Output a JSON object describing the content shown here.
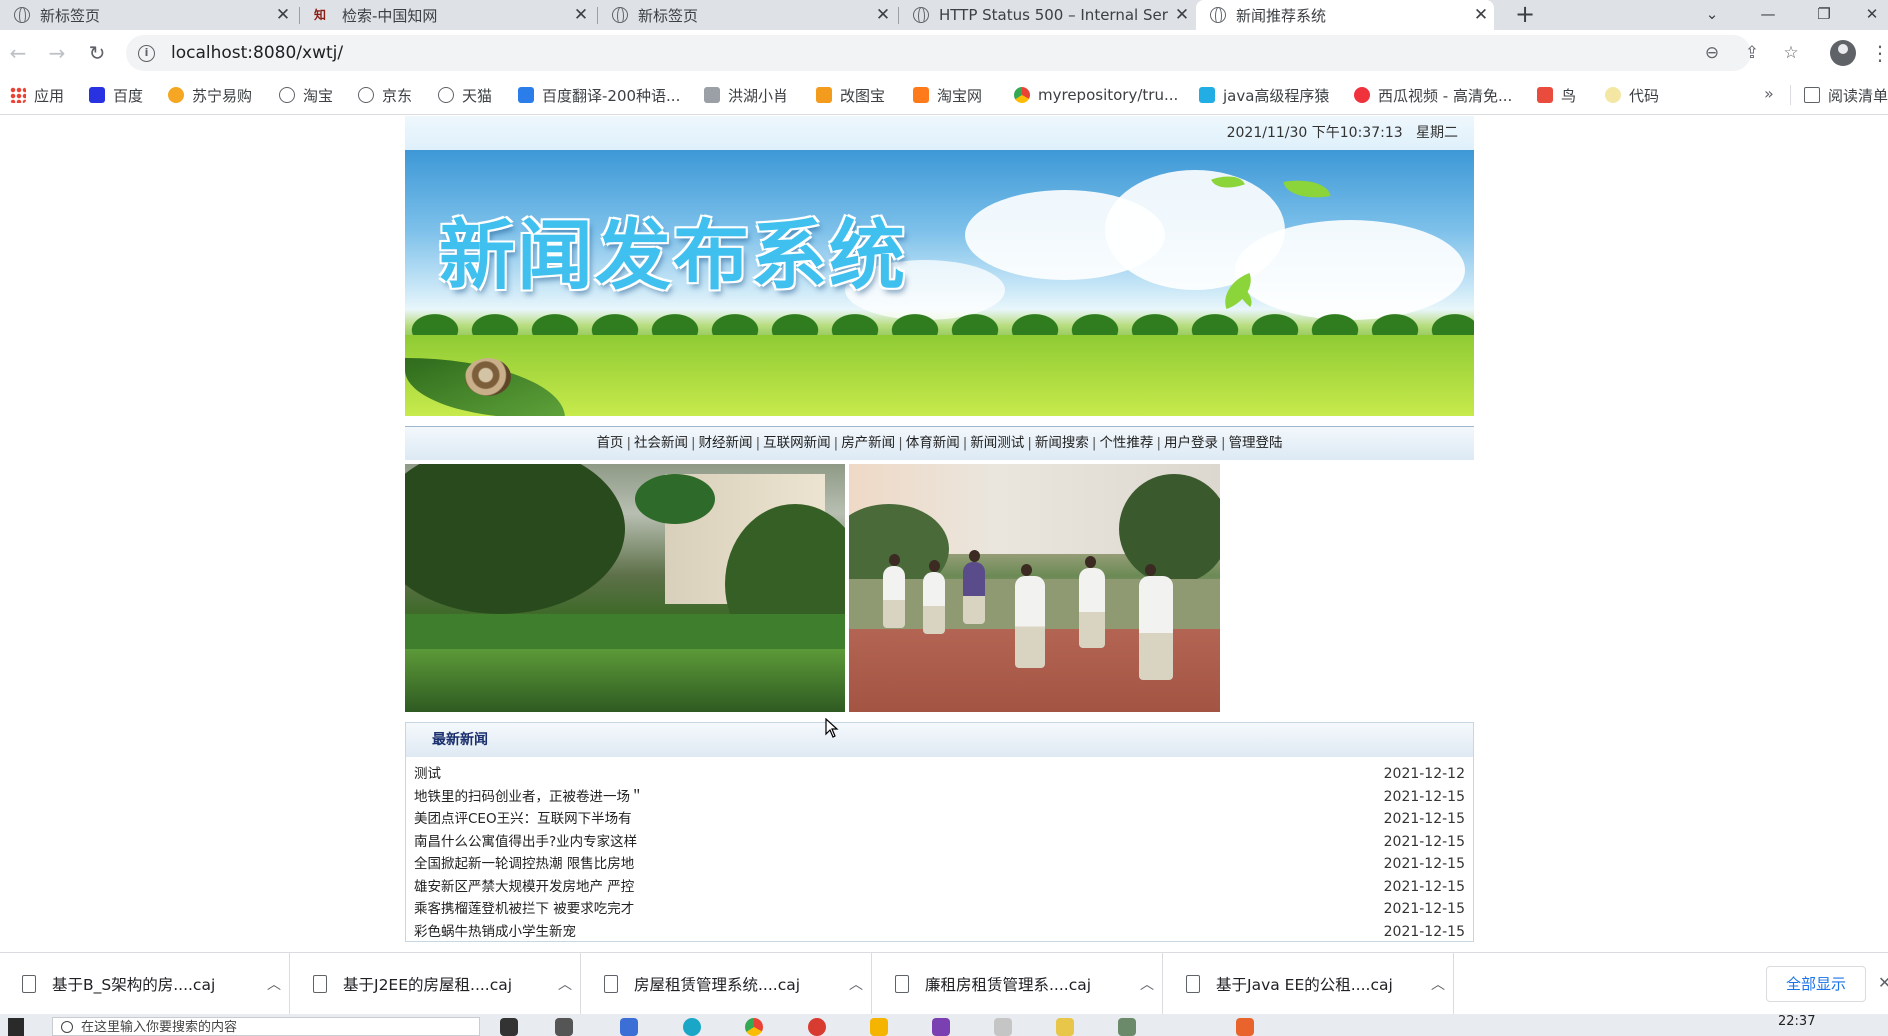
{
  "browser": {
    "tabs": [
      {
        "title": "新标签页",
        "active": false
      },
      {
        "title": "检索-中国知网",
        "active": false
      },
      {
        "title": "新标签页",
        "active": false
      },
      {
        "title": "HTTP Status 500 – Internal Ser",
        "active": false
      },
      {
        "title": "新闻推荐系统",
        "active": true
      }
    ],
    "url": "localhost:8080/xwtj/",
    "bookmarks": [
      {
        "label": "应用"
      },
      {
        "label": "百度"
      },
      {
        "label": "苏宁易购"
      },
      {
        "label": "淘宝"
      },
      {
        "label": "京东"
      },
      {
        "label": "天猫"
      },
      {
        "label": "百度翻译-200种语..."
      },
      {
        "label": "洪湖小肖"
      },
      {
        "label": "改图宝"
      },
      {
        "label": "淘宝网"
      },
      {
        "label": "myrepository/tru..."
      },
      {
        "label": "java高级程序猿"
      },
      {
        "label": "西瓜视频 - 高清免..."
      },
      {
        "label": "鸟"
      },
      {
        "label": "代码"
      },
      {
        "label": "阅读清单"
      }
    ],
    "bookmarks_more": "»"
  },
  "page": {
    "datetime": "2021/11/30 下午10:37:13",
    "weekday": "星期二",
    "banner_title": "新闻发布系统",
    "nav": [
      "首页",
      "社会新闻",
      "财经新闻",
      "互联网新闻",
      "房产新闻",
      "体育新闻",
      "新闻测试",
      "新闻搜索",
      "个性推荐",
      "用户登录",
      "管理登陆"
    ],
    "latest_heading": "最新新闻",
    "news": [
      {
        "title": "测试",
        "date": "2021-12-12"
      },
      {
        "title": "地铁里的扫码创业者，正被卷进一场＂",
        "date": "2021-12-15"
      },
      {
        "title": "美团点评CEO王兴：互联网下半场有",
        "date": "2021-12-15"
      },
      {
        "title": "南昌什么公寓值得出手?业内专家这样",
        "date": "2021-12-15"
      },
      {
        "title": "全国掀起新一轮调控热潮 限售比房地",
        "date": "2021-12-15"
      },
      {
        "title": "雄安新区严禁大规模开发房地产 严控",
        "date": "2021-12-15"
      },
      {
        "title": "乘客携榴莲登机被拦下 被要求吃完才",
        "date": "2021-12-15"
      },
      {
        "title": "彩色蜗牛热销成小学生新宠",
        "date": "2021-12-15"
      }
    ]
  },
  "downloads": {
    "items": [
      {
        "name": "基于B_S架构的房....caj"
      },
      {
        "name": "基于J2EE的房屋租....caj"
      },
      {
        "name": "房屋租赁管理系统....caj"
      },
      {
        "name": "廉租房租赁管理系....caj"
      },
      {
        "name": "基于Java EE的公租....caj"
      }
    ],
    "show_all": "全部显示"
  },
  "taskbar": {
    "search_placeholder": "在这里输入你要搜索的内容",
    "time": "22:37"
  },
  "colors": {
    "tabstrip": "#dee1e6",
    "banner_title": "#3fc0ee",
    "news_heading": "#1a2f6e",
    "link_blue": "#1a73e8"
  }
}
